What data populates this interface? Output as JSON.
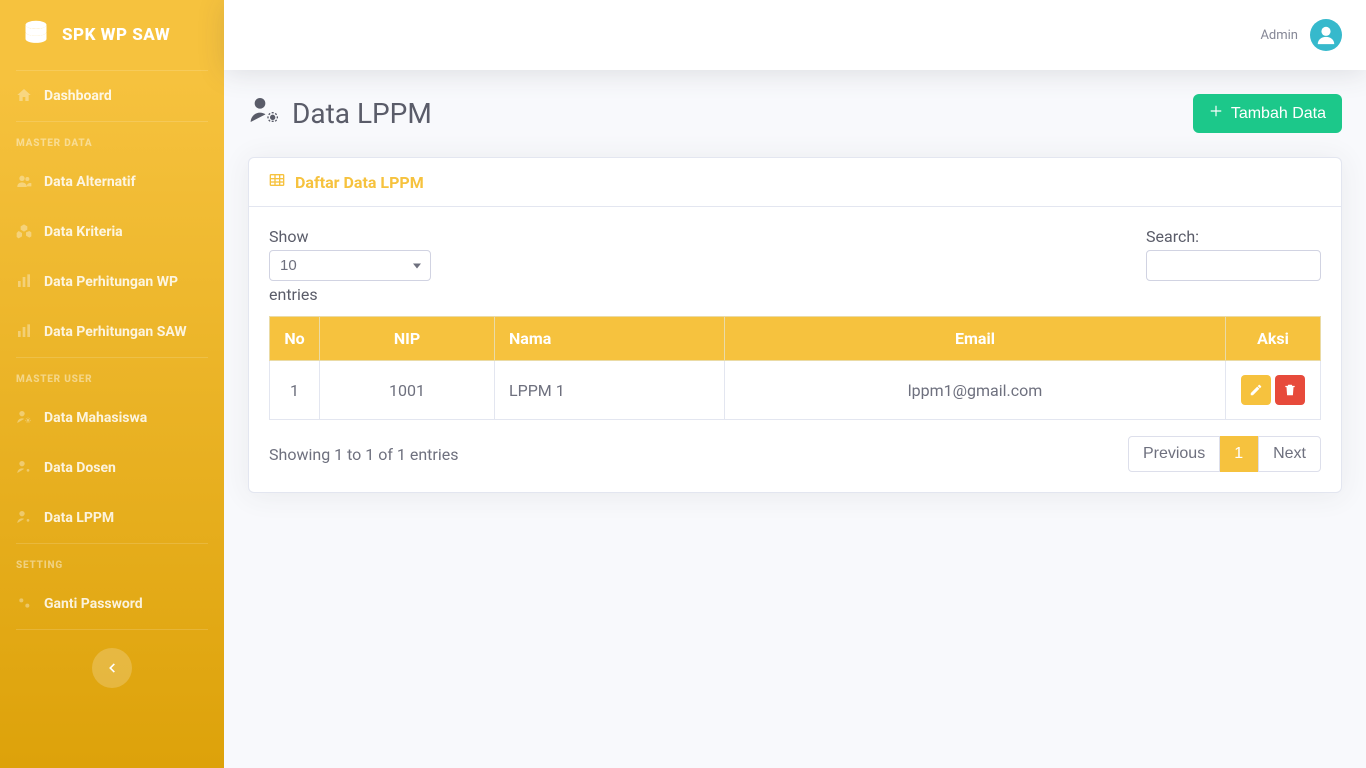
{
  "brand": {
    "title": "SPK WP SAW"
  },
  "sidebar": {
    "dashboard": "Dashboard",
    "heading_master_data": "MASTER DATA",
    "items_master_data": [
      {
        "label": "Data Alternatif"
      },
      {
        "label": "Data Kriteria"
      },
      {
        "label": "Data Perhitungan WP"
      },
      {
        "label": "Data Perhitungan SAW"
      }
    ],
    "heading_master_user": "MASTER USER",
    "items_master_user": [
      {
        "label": "Data Mahasiswa"
      },
      {
        "label": "Data Dosen"
      },
      {
        "label": "Data LPPM"
      }
    ],
    "heading_setting": "SETTING",
    "items_setting": [
      {
        "label": "Ganti Password"
      }
    ]
  },
  "topbar": {
    "user": "Admin"
  },
  "page": {
    "title": "Data LPPM",
    "add_button": "Tambah Data",
    "card_title": "Daftar Data LPPM"
  },
  "table": {
    "show_label": "Show",
    "entries_label": "entries",
    "length_value": "10",
    "search_label": "Search:",
    "search_value": "",
    "columns": [
      "No",
      "NIP",
      "Nama",
      "Email",
      "Aksi"
    ],
    "rows": [
      {
        "no": "1",
        "nip": "1001",
        "nama": "LPPM 1",
        "email": "lppm1@gmail.com"
      }
    ],
    "info": "Showing 1 to 1 of 1 entries",
    "pagination": {
      "prev": "Previous",
      "pages": [
        "1"
      ],
      "next": "Next",
      "active": "1"
    }
  }
}
